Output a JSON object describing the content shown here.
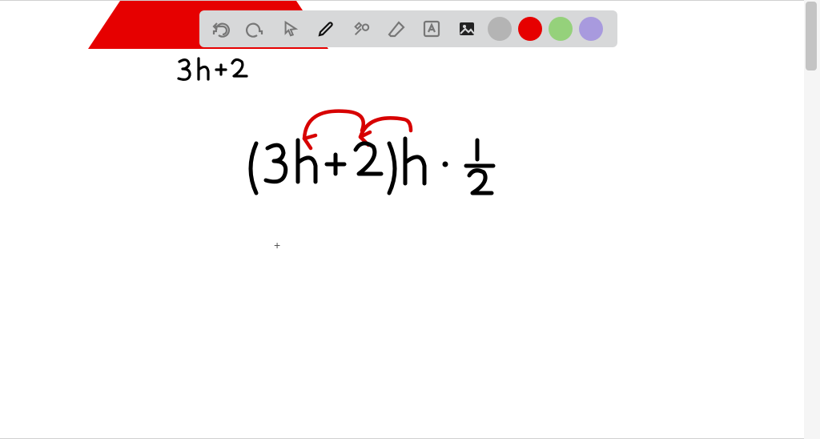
{
  "toolbar": {
    "undo": "undo",
    "redo": "redo",
    "pointer": "pointer",
    "pen": "pen",
    "tools": "tools",
    "eraser": "eraser",
    "text": "text",
    "image": "image",
    "colors": {
      "grey": "#b4b4b4",
      "red": "#e60000",
      "green": "#95d17b",
      "purple": "#a89ade"
    },
    "selected_color": "red",
    "active_tool": "pen"
  },
  "canvas": {
    "triangle_base_label": "3h+2",
    "expression": "(3h+2)h · 1/2",
    "triangle_fill": "#e60000",
    "ink_black": "#000000",
    "ink_red": "#d70000",
    "cursor_symbol": "+"
  }
}
